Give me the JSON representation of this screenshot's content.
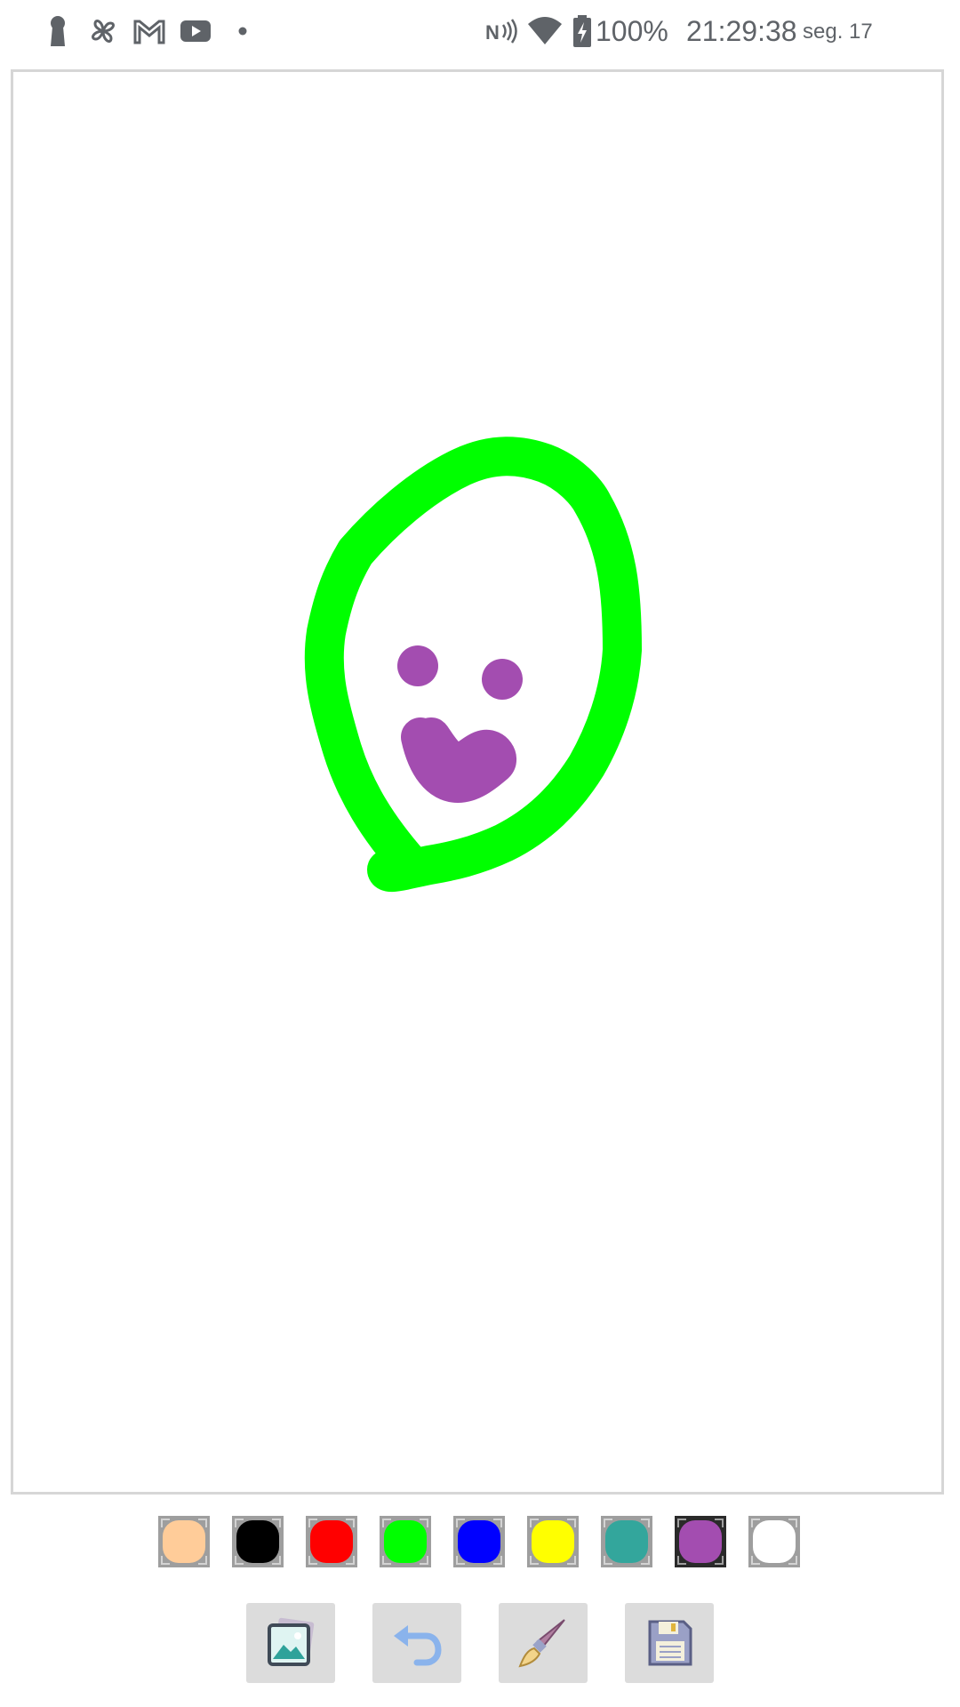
{
  "status_bar": {
    "left_icons": [
      "keyhole-icon",
      "pinwheel-icon",
      "gmail-icon",
      "youtube-icon",
      "notification-dot-icon"
    ],
    "right_icons": [
      "nfc-icon",
      "wifi-icon",
      "battery-charging-icon"
    ],
    "battery": "100%",
    "time": "21:29:38",
    "day": "seg. 17"
  },
  "canvas": {
    "background": "#ffffff",
    "strokes": [
      {
        "name": "green-outline-stroke",
        "color": "#00ff00"
      },
      {
        "name": "purple-left-eye",
        "color": "#a34db0"
      },
      {
        "name": "purple-right-eye",
        "color": "#a34db0"
      },
      {
        "name": "purple-smile-stroke",
        "color": "#a34db0"
      }
    ]
  },
  "palette": {
    "selected": "purple",
    "colors": [
      {
        "name": "peach",
        "hex": "#ffcc99"
      },
      {
        "name": "black",
        "hex": "#000000"
      },
      {
        "name": "red",
        "hex": "#ff0000"
      },
      {
        "name": "green",
        "hex": "#00ff00"
      },
      {
        "name": "blue",
        "hex": "#0000ff"
      },
      {
        "name": "yellow",
        "hex": "#ffff00"
      },
      {
        "name": "teal",
        "hex": "#33a69c"
      },
      {
        "name": "purple",
        "hex": "#a34db0"
      },
      {
        "name": "white",
        "hex": "#ffffff"
      }
    ]
  },
  "toolbar": {
    "buttons": [
      {
        "name": "gallery",
        "icon": "image-icon"
      },
      {
        "name": "undo",
        "icon": "undo-icon"
      },
      {
        "name": "brush",
        "icon": "brush-icon"
      },
      {
        "name": "save",
        "icon": "floppy-disk-icon"
      }
    ]
  }
}
